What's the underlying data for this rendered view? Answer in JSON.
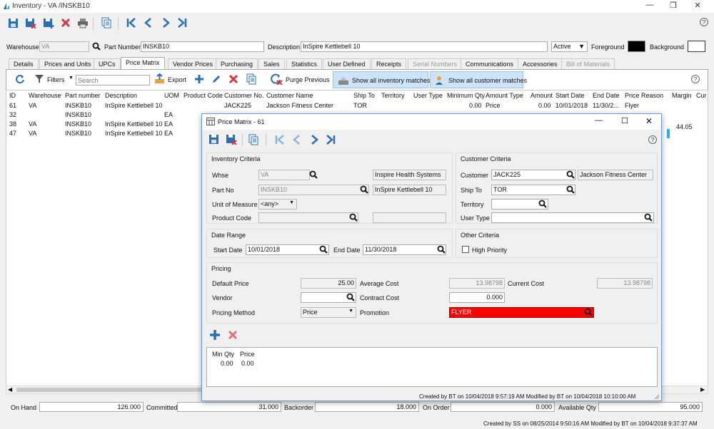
{
  "window": {
    "title": "Inventory - VA   /INSKB10",
    "help": "?"
  },
  "header": {
    "warehouse_label": "Warehouse",
    "warehouse_value": "VA",
    "part_number_label": "Part Number",
    "part_number_value": "INSKB10",
    "description_label": "Description",
    "description_value": "InSpire Kettlebell 10",
    "status_value": "Active",
    "foreground_label": "Foreground",
    "background_label": "Background",
    "foreground_color": "#000000",
    "background_color": "#ffffff"
  },
  "tabs": [
    {
      "label": "Details"
    },
    {
      "label": "Prices and Units"
    },
    {
      "label": "UPCs"
    },
    {
      "label": "Price Matrix"
    },
    {
      "label": "Vendor Prices"
    },
    {
      "label": "Purchasing"
    },
    {
      "label": "Sales"
    },
    {
      "label": "Statistics"
    },
    {
      "label": "User Defined"
    },
    {
      "label": "Receipts"
    },
    {
      "label": "Serial Numbers"
    },
    {
      "label": "Communications"
    },
    {
      "label": "Accessories"
    },
    {
      "label": "Bill of Materials"
    }
  ],
  "toolbar2": {
    "filters_label": "Filters",
    "search_placeholder": "Search",
    "export_label": "Export",
    "purge_label": "Purge Previous",
    "show_inventory_label": "Show all inventory matches",
    "show_customer_label": "Show all customer matches"
  },
  "grid": {
    "columns": [
      "ID",
      "Warehouse",
      "Part number",
      "Description",
      "UOM",
      "Product Code",
      "Customer No.",
      "Customer Name",
      "Ship To",
      "Territory",
      "User Type",
      "Minimum Qty",
      "Amount Type",
      "Amount",
      "Start Date",
      "End Date",
      "Price Reason",
      "Margin",
      "Cur"
    ],
    "rows": [
      {
        "id": "61",
        "warehouse": "VA",
        "part": "INSKB10",
        "desc": "InSpire Kettlebell 10",
        "uom": "",
        "cust_no": "JACK225",
        "cust_name": "Jackson Fitness Center",
        "ship_to": "TOR",
        "min_qty": "0.00",
        "amount_type": "Price",
        "amount": "0.00",
        "start": "10/01/2018",
        "end": "11/30/2...",
        "reason": "Flyer",
        "margin": ""
      },
      {
        "id": "32",
        "warehouse": "",
        "part": "INSKB10",
        "desc": "",
        "uom": "EA",
        "margin": ""
      },
      {
        "id": "38",
        "warehouse": "VA",
        "part": "INSKB10",
        "desc": "InSpire Kettlebell 10",
        "uom": "EA",
        "margin": "44.05"
      },
      {
        "id": "47",
        "warehouse": "VA",
        "part": "INSKB10",
        "desc": "InSpire Kettlebell 10",
        "uom": "EA",
        "margin": ""
      }
    ]
  },
  "footer": {
    "on_hand_label": "On Hand",
    "on_hand_value": "126.000",
    "committed_label": "Committed",
    "committed_value": "31.000",
    "backorder_label": "Backorder",
    "backorder_value": "18.000",
    "on_order_label": "On Order",
    "on_order_value": "0.000",
    "available_label": "Available Qty",
    "available_value": "95.000",
    "created_text": "Created by SS on 08/25/2014 9:50:16 AM  Modified by BT on 10/04/2018 9:37:37 AM"
  },
  "dialog": {
    "title": "Price Matrix - 61",
    "help": "?",
    "inventory_criteria": {
      "title": "Inventory Criteria",
      "whse_label": "Whse",
      "whse_value": "VA",
      "whse_name": "Inspire Health Systems",
      "part_label": "Part No",
      "part_value": "INSKB10",
      "part_desc": "InSpire Kettlebell 10",
      "uom_label": "Unit of Measure",
      "uom_value": "<any>",
      "product_code_label": "Product Code"
    },
    "customer_criteria": {
      "title": "Customer Criteria",
      "customer_label": "Customer",
      "customer_value": "JACK225",
      "customer_name": "Jackson Fitness Center",
      "ship_to_label": "Ship To",
      "ship_to_value": "TOR",
      "territory_label": "Territory",
      "user_type_label": "User Type"
    },
    "date_range": {
      "title": "Date Range",
      "start_label": "Start Date",
      "start_value": "10/01/2018",
      "end_label": "End Date",
      "end_value": "11/30/2018"
    },
    "other_criteria": {
      "title": "Other Criteria",
      "high_priority_label": "High Priority"
    },
    "pricing": {
      "title": "Pricing",
      "default_price_label": "Default Price",
      "default_price_value": "25.00",
      "average_cost_label": "Average Cost",
      "average_cost_value": "13.98798",
      "current_cost_label": "Current Cost",
      "current_cost_value": "13.98798",
      "vendor_label": "Vendor",
      "contract_cost_label": "Contract Cost",
      "contract_cost_value": "0.000",
      "pricing_method_label": "Pricing Method",
      "pricing_method_value": "Price",
      "promotion_label": "Promotion",
      "promotion_value": "FLYER",
      "promotion_color": "#ff0000"
    },
    "qty_table": {
      "headers": [
        "Min Qty",
        "Price"
      ],
      "rows": [
        [
          "0.00",
          "0.00"
        ]
      ]
    },
    "status_text": "Created by BT on 10/04/2018 9:57:19 AM  Modified by BT on 10/04/2018 10:10:00 AM"
  }
}
